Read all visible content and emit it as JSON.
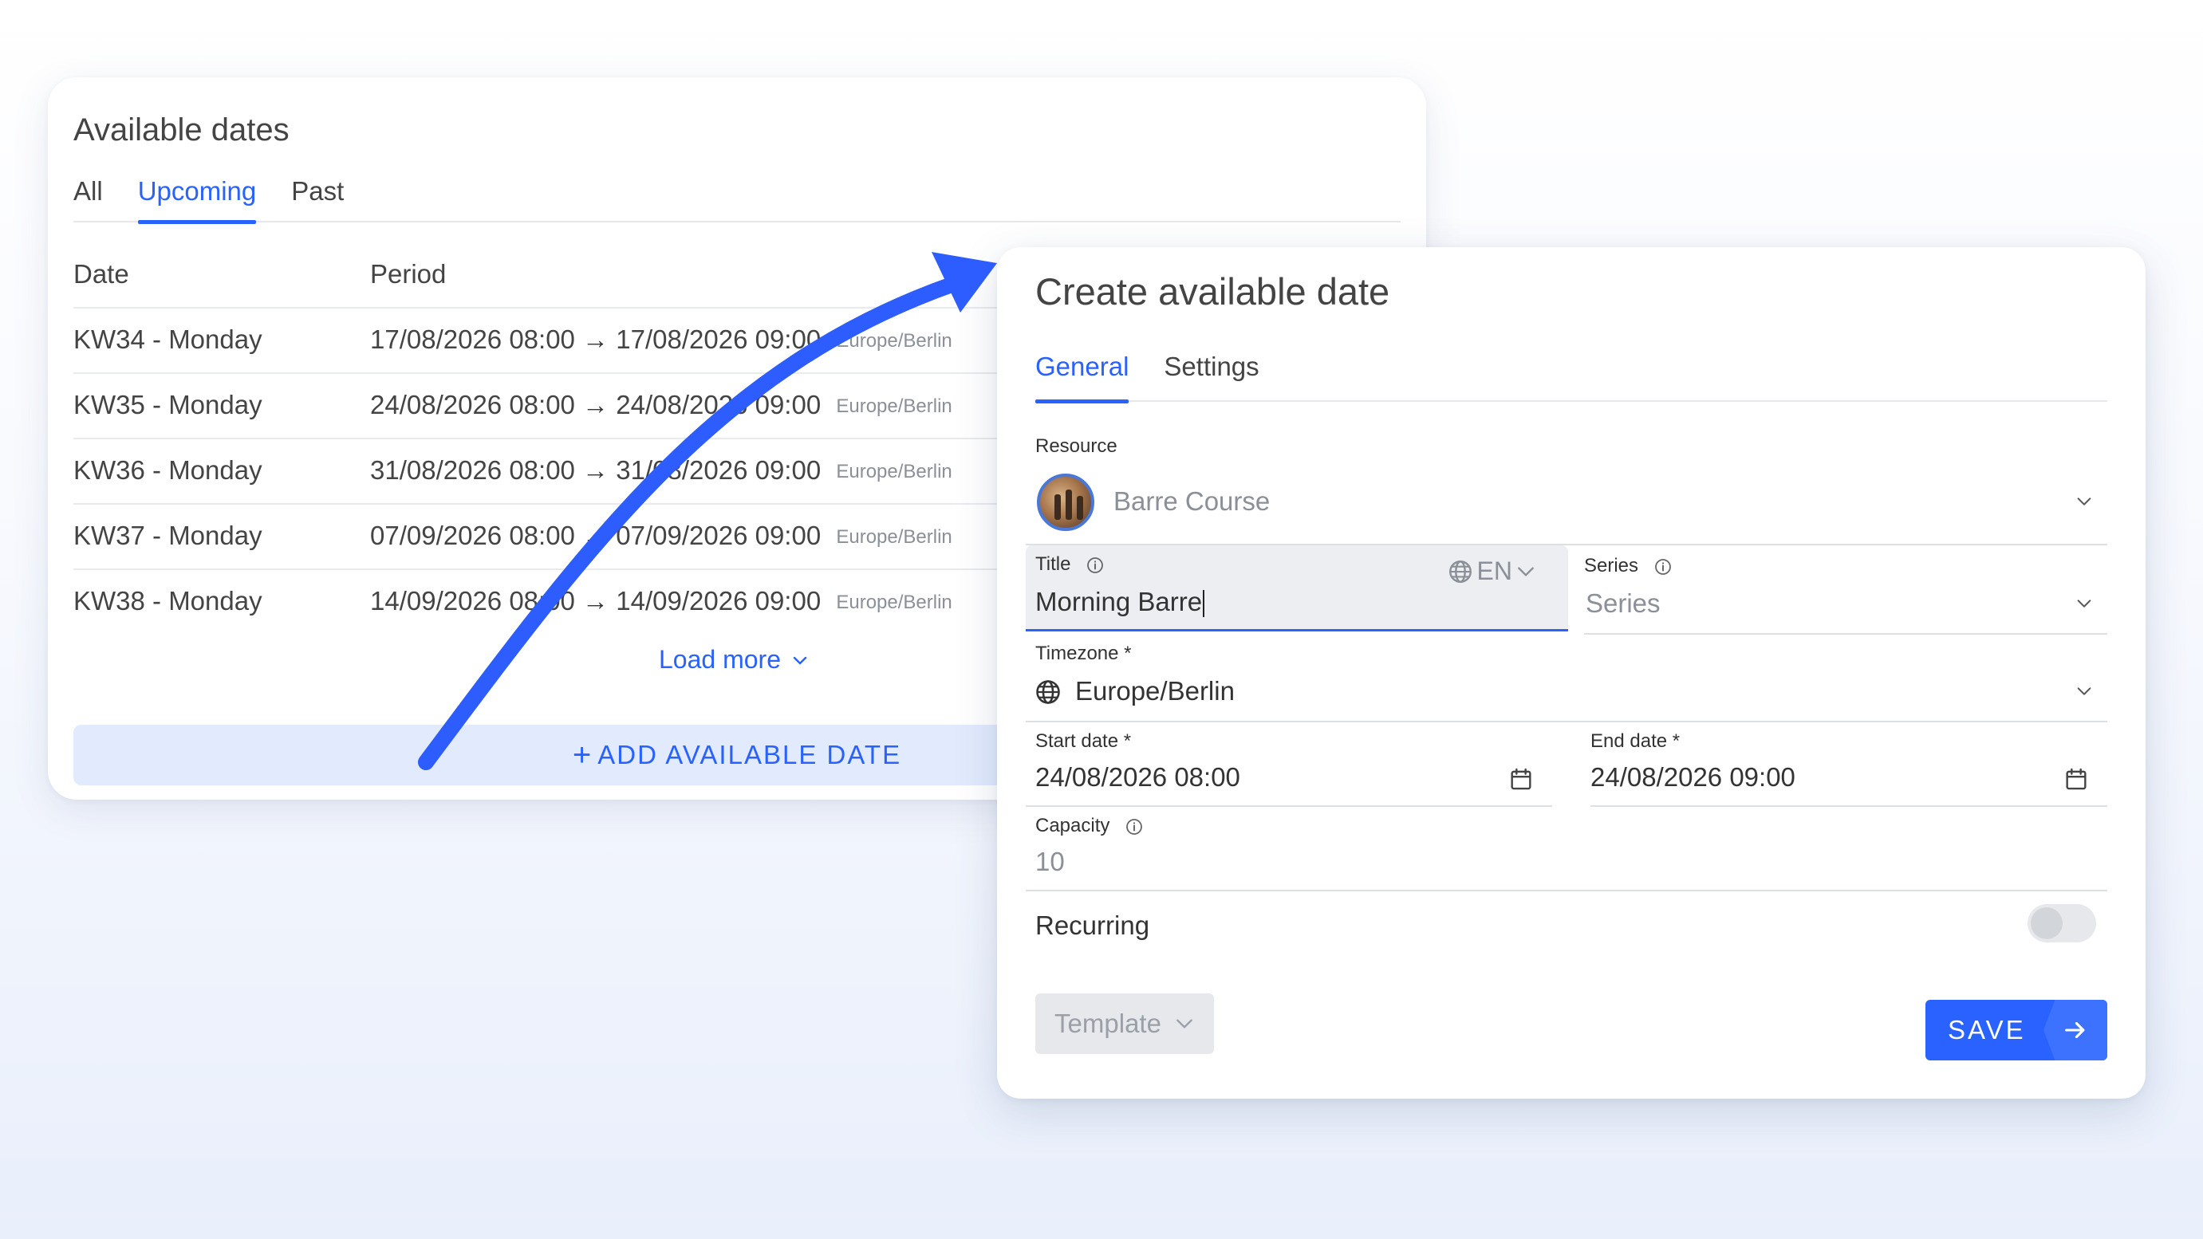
{
  "left_card": {
    "title": "Available dates",
    "tabs": [
      {
        "label": "All"
      },
      {
        "label": "Upcoming",
        "active": true
      },
      {
        "label": "Past"
      }
    ],
    "columns": {
      "date": "Date",
      "period": "Period"
    },
    "rows": [
      {
        "date": "KW34 - Monday",
        "start": "17/08/2026 08:00",
        "end": "17/08/2026 09:00",
        "tz": "Europe/Berlin"
      },
      {
        "date": "KW35 - Monday",
        "start": "24/08/2026 08:00",
        "end": "24/08/2026 09:00",
        "tz": "Europe/Berlin"
      },
      {
        "date": "KW36 - Monday",
        "start": "31/08/2026 08:00",
        "end": "31/08/2026 09:00",
        "tz": "Europe/Berlin"
      },
      {
        "date": "KW37 - Monday",
        "start": "07/09/2026 08:00",
        "end": "07/09/2026 09:00",
        "tz": "Europe/Berlin"
      },
      {
        "date": "KW38 - Monday",
        "start": "14/09/2026 08:00",
        "end": "14/09/2026 09:00",
        "tz": "Europe/Berlin"
      }
    ],
    "load_more": "Load more",
    "add_button": "ADD AVAILABLE DATE"
  },
  "right_card": {
    "title": "Create available date",
    "tabs": [
      {
        "label": "General",
        "active": true
      },
      {
        "label": "Settings"
      }
    ],
    "resource": {
      "label": "Resource",
      "value": "Barre Course"
    },
    "title_field": {
      "label": "Title",
      "value": "Morning Barre",
      "lang": "EN"
    },
    "series": {
      "label": "Series",
      "placeholder": "Series"
    },
    "timezone": {
      "label": "Timezone *",
      "value": "Europe/Berlin"
    },
    "start_date": {
      "label": "Start date *",
      "value": "24/08/2026 08:00"
    },
    "end_date": {
      "label": "End date *",
      "value": "24/08/2026 09:00"
    },
    "capacity": {
      "label": "Capacity",
      "placeholder": "10"
    },
    "recurring": {
      "label": "Recurring",
      "enabled": false
    },
    "template_button": "Template",
    "save_button": "SAVE"
  },
  "colors": {
    "accent": "#2962ff",
    "add_button_bg": "#e2ebfd",
    "annotation_arrow": "#2d5cff"
  }
}
